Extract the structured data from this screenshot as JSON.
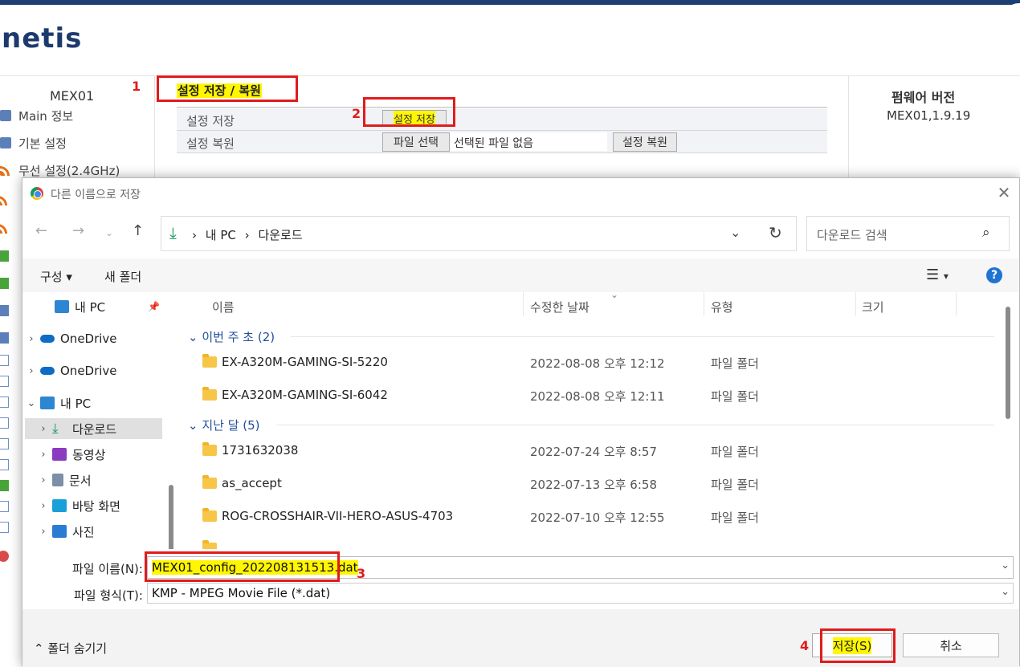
{
  "brand": {
    "logo": "netis"
  },
  "sidebar": {
    "model": "MEX01",
    "items": [
      {
        "label": "Main 정보",
        "icon": "info-icon"
      },
      {
        "label": "기본 설정",
        "icon": "settings-icon"
      },
      {
        "label": "무선 설정(2.4GHz)",
        "icon": "wireless-icon"
      }
    ]
  },
  "content": {
    "section_title": "설정 저장 / 복원",
    "save_row_label": "설정 저장",
    "save_button": "설정 저장",
    "restore_row_label": "설정 복원",
    "choose_file_button": "파일 선택",
    "no_file_text": "선택된 파일 없음",
    "restore_button": "설정 복원"
  },
  "firmware": {
    "title": "펌웨어 버전",
    "version": "MEX01,1.9.19"
  },
  "annotations": [
    "1",
    "2",
    "3",
    "4"
  ],
  "dialog": {
    "title": "다른 이름으로 저장",
    "address": {
      "crumbs": [
        "내 PC",
        "다운로드"
      ]
    },
    "search_placeholder": "다운로드 검색",
    "toolbar": {
      "organize": "구성",
      "new_folder": "새 폴더"
    },
    "nav": [
      {
        "label": "내 PC",
        "icon": "pc-icon"
      },
      {
        "label": "OneDrive",
        "icon": "onedrive-icon"
      },
      {
        "label": "OneDrive",
        "icon": "onedrive-icon"
      },
      {
        "label": "내 PC",
        "icon": "pc-icon"
      },
      {
        "label": "다운로드",
        "icon": "download-icon"
      },
      {
        "label": "동영상",
        "icon": "video-icon"
      },
      {
        "label": "문서",
        "icon": "document-icon"
      },
      {
        "label": "바탕 화면",
        "icon": "desktop-icon"
      },
      {
        "label": "사진",
        "icon": "pictures-icon"
      }
    ],
    "columns": {
      "name": "이름",
      "date": "수정한 날짜",
      "type": "유형",
      "size": "크기"
    },
    "groups": [
      {
        "label": "이번 주 초 (2)",
        "files": [
          {
            "name": "EX-A320M-GAMING-SI-5220",
            "date": "2022-08-08 오후 12:12",
            "type": "파일 폴더"
          },
          {
            "name": "EX-A320M-GAMING-SI-6042",
            "date": "2022-08-08 오후 12:11",
            "type": "파일 폴더"
          }
        ]
      },
      {
        "label": "지난 달 (5)",
        "files": [
          {
            "name": "1731632038",
            "date": "2022-07-24 오후 8:57",
            "type": "파일 폴더"
          },
          {
            "name": "as_accept",
            "date": "2022-07-13 오후 6:58",
            "type": "파일 폴더"
          },
          {
            "name": "ROG-CROSSHAIR-VII-HERO-ASUS-4703",
            "date": "2022-07-10 오후 12:55",
            "type": "파일 폴더"
          }
        ]
      }
    ],
    "filename_label": "파일 이름(N):",
    "filename_value": "MEX01_config_202208131513.dat",
    "filetype_label": "파일 형식(T):",
    "filetype_value": "KMP - MPEG Movie File (*.dat)",
    "hide_folders": "폴더 숨기기",
    "save_button": "저장(S)",
    "cancel_button": "취소"
  },
  "colors": {
    "highlight": "#fff600",
    "annotation": "#e01b1b",
    "brand": "#1d3a6e"
  }
}
